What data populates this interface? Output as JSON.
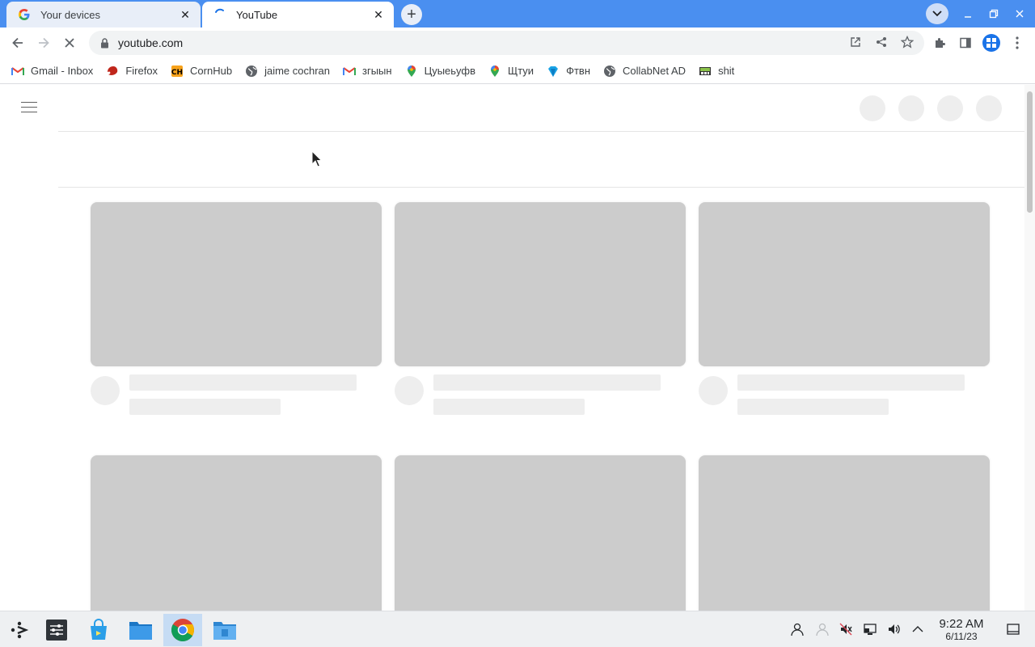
{
  "tabs": [
    {
      "title": "Your devices",
      "icon": "google-g-icon",
      "close": "✕"
    },
    {
      "title": "YouTube",
      "icon": "loading-spinner-icon",
      "close": "✕"
    }
  ],
  "new_tab_label": "+",
  "toolbar": {
    "url": "youtube.com"
  },
  "bookmarks": [
    {
      "label": "Gmail - Inbox",
      "icon": "gmail-icon"
    },
    {
      "label": "Firefox",
      "icon": "firefox-icon"
    },
    {
      "label": "CornHub",
      "icon": "cornhub-icon"
    },
    {
      "label": "jaime cochran",
      "icon": "globe-icon"
    },
    {
      "label": "згыын",
      "icon": "gmail-icon"
    },
    {
      "label": "Цуыеьуфв",
      "icon": "maps-pin-icon"
    },
    {
      "label": "Щтуи",
      "icon": "maps-pin-icon"
    },
    {
      "label": "Фтвн",
      "icon": "diamond-icon"
    },
    {
      "label": "CollabNet AD",
      "icon": "globe-icon"
    },
    {
      "label": "shit",
      "icon": "site-icon"
    }
  ],
  "colors": {
    "tabstrip": "#4a8ff0",
    "skeleton_thumb": "#cccccc",
    "skeleton_line": "#eeeeee"
  },
  "taskbar": {
    "time": "9:22 AM",
    "date": "6/11/23",
    "apps": [
      "app-launcher-icon",
      "settings-panel-icon",
      "store-icon",
      "file-manager-icon",
      "chrome-icon",
      "files-app-icon"
    ]
  }
}
